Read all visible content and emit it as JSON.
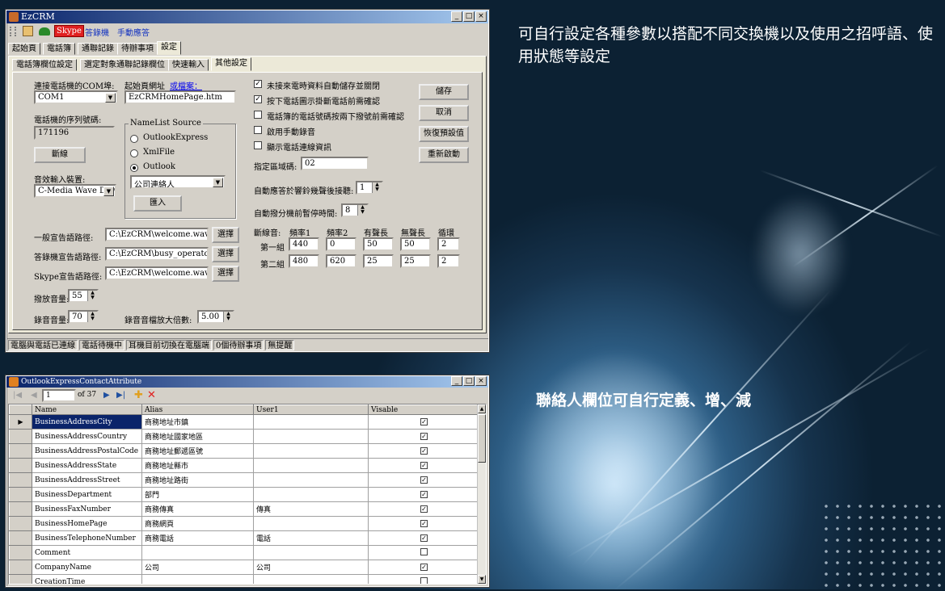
{
  "captions": {
    "top": "可自行設定各種參數以搭配不同交換機以及使用之招呼語、使用狀態等設定",
    "bottom": "聯絡人欄位可自行定義、增、減"
  },
  "win1": {
    "title": "EzCRM",
    "toolbar": [
      "Skype",
      "答錄機",
      "手動應答"
    ],
    "main_tabs": [
      "起始頁",
      "電話簿",
      "通聯記錄",
      "待辦事項",
      "設定"
    ],
    "sub_tabs": [
      "電話簿欄位設定",
      "選定對象通聯記錄欄位",
      "快速輸入",
      "其他設定"
    ],
    "com_label": "連接電話機的COM埠:",
    "com_value": "COM1",
    "home_label": "起始頁網址",
    "home_link": "或檔案：",
    "home_value": "EzCRMHomePage.htm",
    "serial_label": "電話機的序列號碼:",
    "serial_value": "171196",
    "disconnect_btn": "斷線",
    "audio_label": "音效輸入裝置:",
    "audio_value": "C-Media Wave Devic",
    "namelist_legend": "NameList Source",
    "radios": [
      "OutlookExpress",
      "XmlFile",
      "Outlook"
    ],
    "contact_select": "公司連絡人",
    "import_btn": "匯入",
    "checks": [
      {
        "label": "未接來電時資料自動儲存並關閉",
        "checked": true
      },
      {
        "label": "按下電話圖示掛斷電話前需確認",
        "checked": true
      },
      {
        "label": "電話簿的電話號碼按兩下撥號前需確認",
        "checked": false
      },
      {
        "label": "啟用手動錄音",
        "checked": false
      },
      {
        "label": "顯示電話連線資訊",
        "checked": false
      }
    ],
    "area_label": "指定區域碼:",
    "area_value": "02",
    "autoanswer_label": "自動應答於響鈴幾聲後接聽:",
    "autoanswer_value": "1",
    "pause_label": "自動撥分機前暫停時間:",
    "pause_value": "8",
    "side_buttons": [
      "儲存",
      "取消",
      "恢復預設值",
      "重新啟動"
    ],
    "tone": {
      "headers": [
        "斷線音:",
        "頻率1",
        "頻率2",
        "有聲長",
        "無聲長",
        "循環"
      ],
      "rows": [
        {
          "label": "第一組",
          "values": [
            "440",
            "0",
            "50",
            "50",
            "2"
          ]
        },
        {
          "label": "第二組",
          "values": [
            "480",
            "620",
            "25",
            "25",
            "2"
          ]
        }
      ]
    },
    "greetings": [
      {
        "label": "一般宣告語路徑:",
        "value": "C:\\EzCRM\\welcome.wav"
      },
      {
        "label": "答錄機宣告語路徑:",
        "value": "C:\\EzCRM\\busy_operator.wav"
      },
      {
        "label": "Skype宣告語路徑:",
        "value": "C:\\EzCRM\\welcome.wav"
      }
    ],
    "choose_btn": "選擇",
    "playback_label": "撥放音量:",
    "playback_value": "55",
    "record_label": "錄音音量:",
    "record_value": "70",
    "amp_label": "錄音音檔放大倍數:",
    "amp_value": "5.00",
    "status": [
      "電腦與電話已連線",
      "電話待機中",
      "耳機目前切換在電腦端",
      "0個待辦事項",
      "無提醒"
    ]
  },
  "win2": {
    "title": "OutlookExpressContactAttribute",
    "position": "1",
    "of_total": "of 37",
    "columns": [
      "Name",
      "Alias",
      "User1",
      "Visable"
    ],
    "rows": [
      {
        "name": "BusinessAddressCity",
        "alias": "商務地址市鎮",
        "user1": "",
        "visible": true
      },
      {
        "name": "BusinessAddressCountry",
        "alias": "商務地址國家地區",
        "user1": "",
        "visible": true
      },
      {
        "name": "BusinessAddressPostalCode",
        "alias": "商務地址郵遞區號",
        "user1": "",
        "visible": true
      },
      {
        "name": "BusinessAddressState",
        "alias": "商務地址縣市",
        "user1": "",
        "visible": true
      },
      {
        "name": "BusinessAddressStreet",
        "alias": "商務地址路街",
        "user1": "",
        "visible": true
      },
      {
        "name": "BusinessDepartment",
        "alias": "部門",
        "user1": "",
        "visible": true
      },
      {
        "name": "BusinessFaxNumber",
        "alias": "商務傳真",
        "user1": "傳真",
        "visible": true
      },
      {
        "name": "BusinessHomePage",
        "alias": "商務網頁",
        "user1": "",
        "visible": true
      },
      {
        "name": "BusinessTelephoneNumber",
        "alias": "商務電話",
        "user1": "電話",
        "visible": true
      },
      {
        "name": "Comment",
        "alias": "",
        "user1": "",
        "visible": false
      },
      {
        "name": "CompanyName",
        "alias": "公司",
        "user1": "公司",
        "visible": true
      },
      {
        "name": "CreationTime",
        "alias": "",
        "user1": "",
        "visible": false
      }
    ]
  }
}
